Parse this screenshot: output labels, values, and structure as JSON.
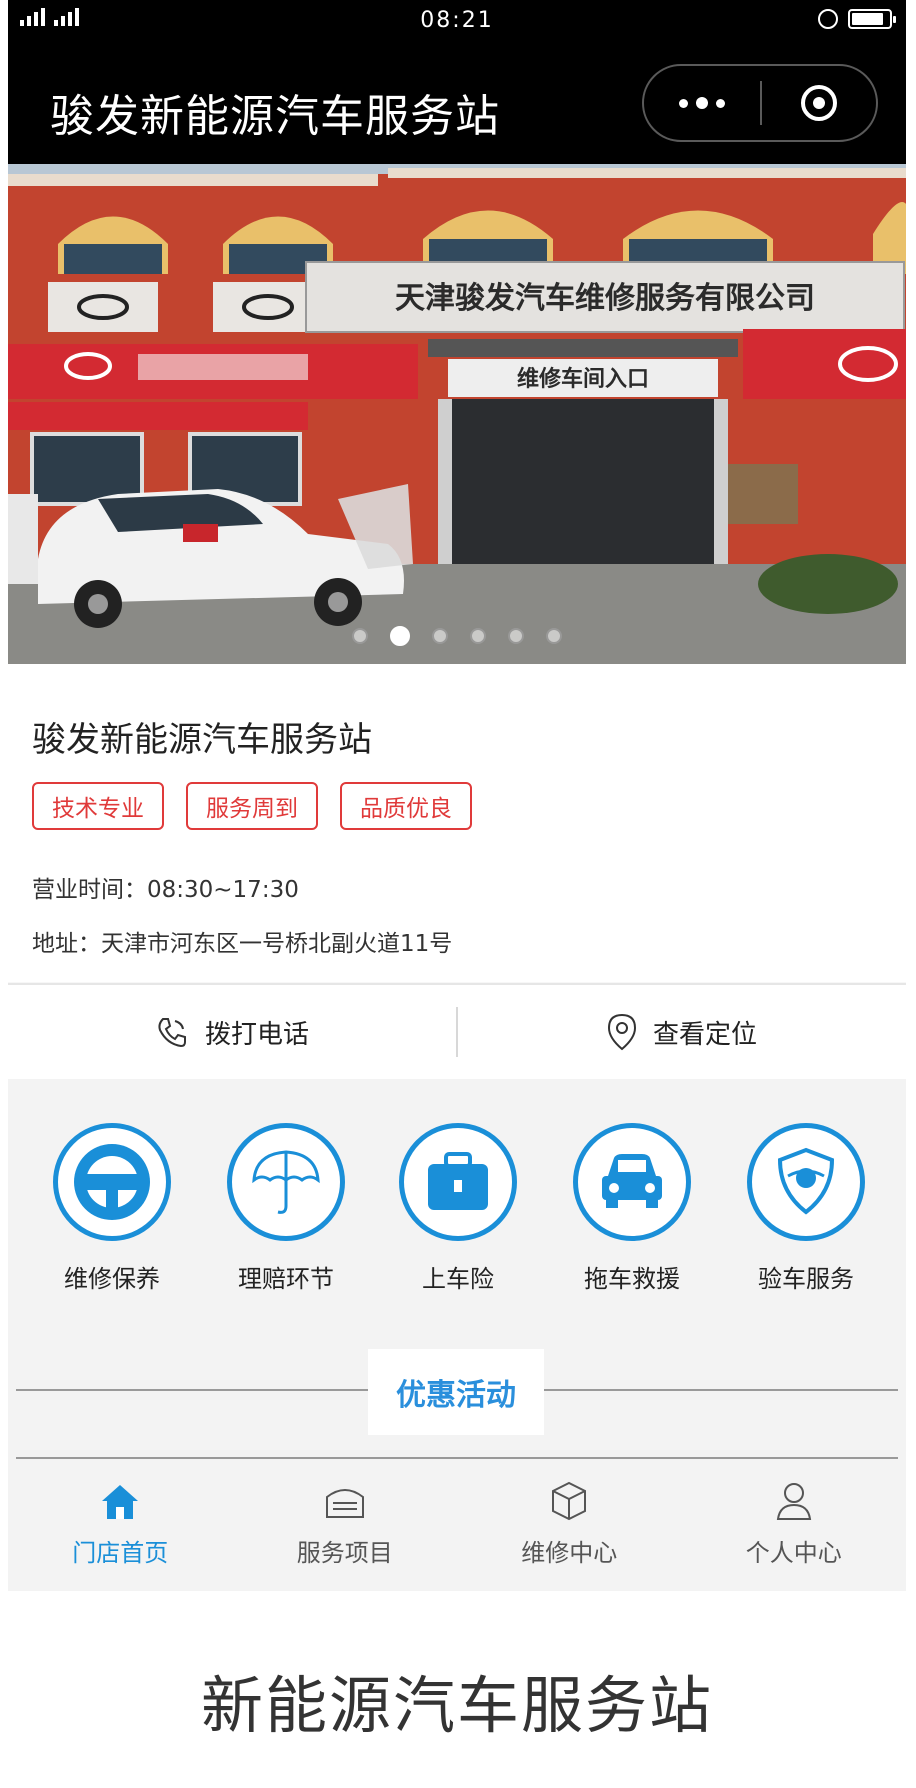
{
  "status_bar": {
    "time": "08:21"
  },
  "nav": {
    "title": "骏发新能源汽车服务站"
  },
  "banner": {
    "sign_company": "天津骏发汽车维修服务有限公司",
    "sign_entrance": "维修车间入口",
    "slide_count": 6,
    "active_slide": 2
  },
  "store": {
    "name": "骏发新能源汽车服务站",
    "tags": [
      "技术专业",
      "服务周到",
      "品质优良"
    ],
    "hours": "营业时间：08:30~17:30",
    "address": "地址：天津市河东区一号桥北副火道11号"
  },
  "actions": {
    "call": "拨打电话",
    "locate": "查看定位"
  },
  "services": [
    {
      "label": "维修保养",
      "icon": "steering-wheel-icon"
    },
    {
      "label": "理赔环节",
      "icon": "umbrella-icon"
    },
    {
      "label": "上车险",
      "icon": "briefcase-icon"
    },
    {
      "label": "拖车救援",
      "icon": "car-icon"
    },
    {
      "label": "验车服务",
      "icon": "shield-icon"
    }
  ],
  "promo": {
    "label": "优惠活动"
  },
  "tabbar": {
    "items": [
      {
        "label": "门店首页",
        "icon": "home-icon",
        "active": true
      },
      {
        "label": "服务项目",
        "icon": "garage-icon",
        "active": false
      },
      {
        "label": "维修中心",
        "icon": "box-icon",
        "active": false
      },
      {
        "label": "个人中心",
        "icon": "person-icon",
        "active": false
      }
    ]
  },
  "bottom_banner": {
    "title": "新能源汽车服务站"
  },
  "colors": {
    "accent": "#1a8fd8",
    "tag_red": "#e03a3a",
    "navbar_bg": "#000000"
  }
}
